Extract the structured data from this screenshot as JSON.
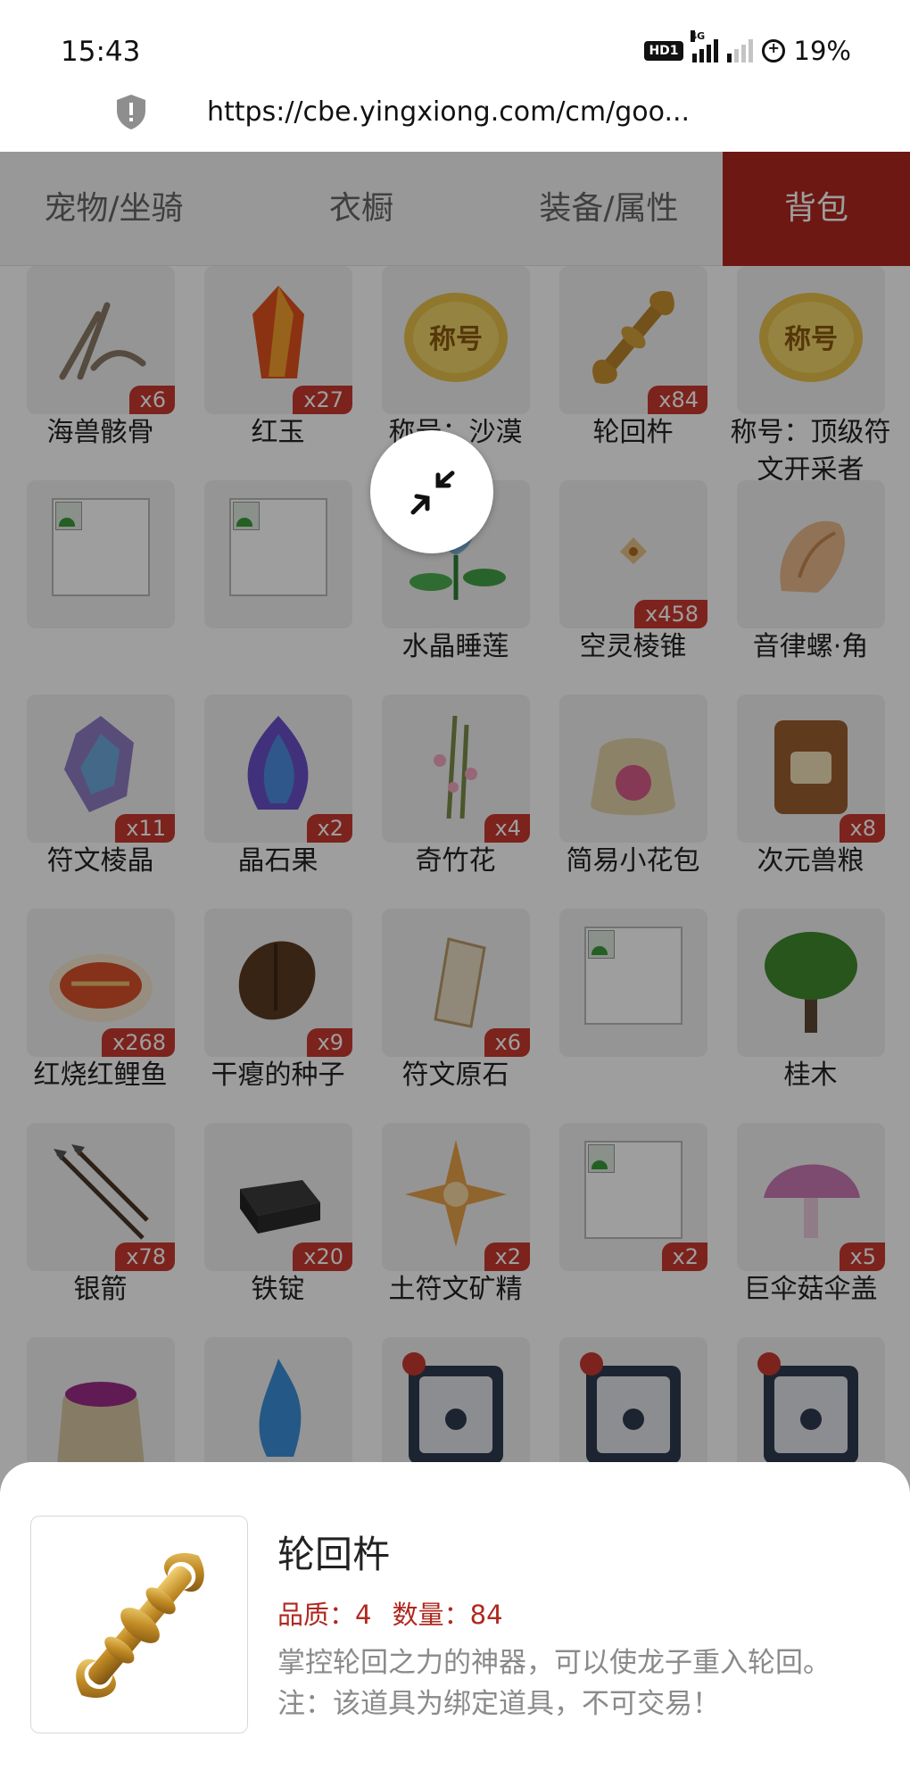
{
  "status_bar": {
    "time": "15:43",
    "hd_label": "HD1",
    "network_label": "4G",
    "battery": "19%"
  },
  "url_bar": {
    "url": "https://cbe.yingxiong.com/cm/goo..."
  },
  "tabs": [
    {
      "label": "宠物/坐骑",
      "active": false
    },
    {
      "label": "衣橱",
      "active": false
    },
    {
      "label": "装备/属性",
      "active": false
    },
    {
      "label": "背包",
      "active": true
    }
  ],
  "items": [
    {
      "name": "海兽骸骨",
      "count": "x6",
      "icon": "bone-icon"
    },
    {
      "name": "红玉",
      "count": "x27",
      "icon": "red-crystal-icon"
    },
    {
      "name": "称号：沙漠",
      "count": "",
      "icon": "title-badge-icon",
      "icon_text": "称号"
    },
    {
      "name": "轮回杵",
      "count": "x84",
      "icon": "golden-vajra-icon"
    },
    {
      "name": "称号：顶级符文开采者",
      "count": "",
      "icon": "title-badge-icon",
      "icon_text": "称号"
    },
    {
      "name": "",
      "count": "",
      "icon": "broken-image-icon"
    },
    {
      "name": "",
      "count": "",
      "icon": "broken-image-icon"
    },
    {
      "name": "水晶睡莲",
      "count": "",
      "icon": "lotus-icon"
    },
    {
      "name": "空灵棱锥",
      "count": "x458",
      "icon": "pyramid-icon"
    },
    {
      "name": "音律螺·角",
      "count": "",
      "icon": "conch-icon"
    },
    {
      "name": "符文棱晶",
      "count": "x11",
      "icon": "rune-prism-icon"
    },
    {
      "name": "晶石果",
      "count": "x2",
      "icon": "crystal-fruit-icon"
    },
    {
      "name": "奇竹花",
      "count": "x4",
      "icon": "bamboo-flower-icon"
    },
    {
      "name": "简易小花包",
      "count": "",
      "icon": "flower-bag-icon"
    },
    {
      "name": "次元兽粮",
      "count": "x8",
      "icon": "feed-bag-icon"
    },
    {
      "name": "红烧红鲤鱼",
      "count": "x268",
      "icon": "fish-dish-icon"
    },
    {
      "name": "干瘪的种子",
      "count": "x9",
      "icon": "seed-icon"
    },
    {
      "name": "符文原石",
      "count": "x6",
      "icon": "rune-stone-icon"
    },
    {
      "name": "",
      "count": "",
      "icon": "broken-image-icon"
    },
    {
      "name": "桂木",
      "count": "",
      "icon": "tree-icon"
    },
    {
      "name": "银箭",
      "count": "x78",
      "icon": "arrows-icon"
    },
    {
      "name": "铁锭",
      "count": "x20",
      "icon": "iron-ingot-icon"
    },
    {
      "name": "土符文矿精",
      "count": "x2",
      "icon": "ore-essence-icon"
    },
    {
      "name": "",
      "count": "x2",
      "icon": "broken-image-icon"
    },
    {
      "name": "巨伞菇伞盖",
      "count": "x5",
      "icon": "mushroom-icon"
    },
    {
      "name": "",
      "count": "",
      "icon": "seed-sack-icon"
    },
    {
      "name": "",
      "count": "",
      "icon": "blue-flame-icon"
    },
    {
      "name": "",
      "count": "",
      "icon": "pet-cage-icon"
    },
    {
      "name": "",
      "count": "",
      "icon": "pet-cage-icon"
    },
    {
      "name": "",
      "count": "",
      "icon": "pet-cage-icon"
    }
  ],
  "detail": {
    "title": "轮回杵",
    "quality": "品质：4",
    "quantity": "数量：84",
    "description": "掌控轮回之力的神器，可以使龙子重入轮回。注：该道具为绑定道具，不可交易！",
    "icon": "golden-vajra-icon"
  }
}
